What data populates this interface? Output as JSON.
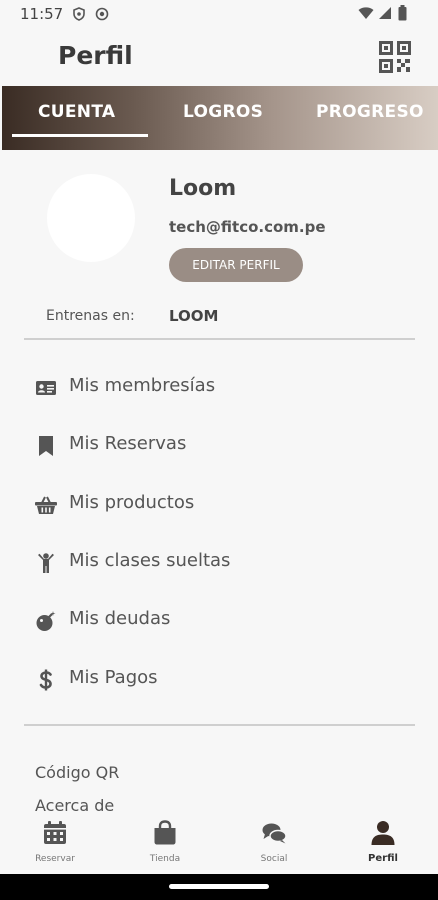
{
  "status_bar": {
    "time": "11:57"
  },
  "header": {
    "title": "Perfil"
  },
  "tabs": [
    {
      "label": "CUENTA",
      "active": true
    },
    {
      "label": "LOGROS",
      "active": false
    },
    {
      "label": "PROGRESO",
      "active": false
    }
  ],
  "profile": {
    "name": "Loom",
    "email": "tech@fitco.com.pe",
    "edit_label": "EDITAR PERFIL",
    "train_label": "Entrenas en:",
    "train_value": "LOOM"
  },
  "menu": [
    {
      "label": "Mis membresías",
      "icon": "id-card-icon"
    },
    {
      "label": "Mis Reservas",
      "icon": "bookmark-icon"
    },
    {
      "label": "Mis productos",
      "icon": "basket-icon"
    },
    {
      "label": "Mis clases sueltas",
      "icon": "person-icon"
    },
    {
      "label": "Mis deudas",
      "icon": "bomb-icon"
    },
    {
      "label": "Mis Pagos",
      "icon": "dollar-icon"
    }
  ],
  "links": [
    {
      "label": "Código QR"
    },
    {
      "label": "Acerca de"
    }
  ],
  "bottom_nav": [
    {
      "label": "Reservar",
      "icon": "calendar-icon",
      "active": false
    },
    {
      "label": "Tienda",
      "icon": "shopping-bag-icon",
      "active": false
    },
    {
      "label": "Social",
      "icon": "chat-icon",
      "active": false
    },
    {
      "label": "Perfil",
      "icon": "user-icon",
      "active": true
    }
  ],
  "colors": {
    "tab_gradient_start": "#3a2c24",
    "tab_gradient_end": "#d8cdc4",
    "button": "#9a8d85",
    "text": "#555555"
  }
}
